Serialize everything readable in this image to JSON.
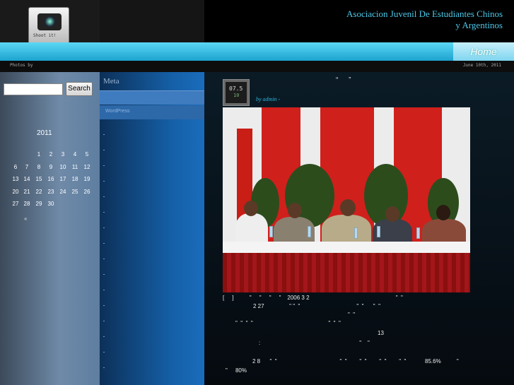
{
  "header": {
    "logo_caption": "Shoot it!",
    "site_title_line1": "Asociacion Juvenil De Estudiantes Chinos",
    "site_title_line2": "y Argentinos"
  },
  "nav": {
    "home_label": "Home"
  },
  "subbar": {
    "left_text": "Photos by",
    "date_text": "June 10th, 2011"
  },
  "search": {
    "button_label": "Search",
    "input_value": ""
  },
  "calendar": {
    "caption": "2011",
    "rows": [
      [
        "",
        "",
        "1",
        "2",
        "3",
        "4",
        "5"
      ],
      [
        "6",
        "7",
        "8",
        "9",
        "10",
        "11",
        "12"
      ],
      [
        "13",
        "14",
        "15",
        "16",
        "17",
        "18",
        "19"
      ],
      [
        "20",
        "21",
        "22",
        "23",
        "24",
        "25",
        "26"
      ],
      [
        "27",
        "28",
        "29",
        "30",
        "",
        "",
        ""
      ]
    ],
    "prev_link": "«"
  },
  "meta": {
    "title": "Meta",
    "wordpress_link": "WordPress"
  },
  "post": {
    "date_day": "07.5",
    "date_year": "10",
    "title": "“ ”",
    "byline": "by admin -",
    "body": {
      "line1": "[     ]          \"     \"     \"     \"    2006 3 2                                                       \"  \"",
      "line2": "2 27                \" \"  \"                                    \"  \"      \"  \"",
      "line3": "\"  \"",
      "line4": "\"  \"  \"  \"                                                \"  \"  \"",
      "line5": "13",
      "line6": ":                                                               \"    \"",
      "line7": "2 8      \"  \"                                        \"  \"        \"  \"        \"  \"        \"  \"            85.6%          \"",
      "line8": "\"     80%"
    }
  },
  "colors": {
    "accent_cyan": "#4cc8e8",
    "nav_bar": "#1da3cf",
    "sidebar_blue": "#1560a8",
    "content_bg": "#0b1b26"
  }
}
